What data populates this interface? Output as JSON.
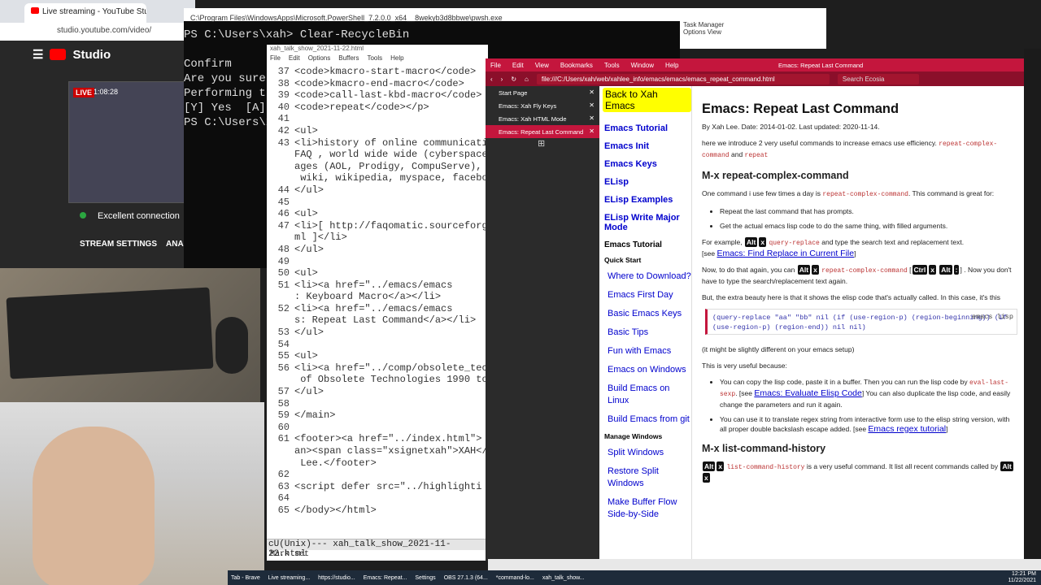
{
  "studio": {
    "tab_title": "Live streaming - YouTube Studio",
    "url": "studio.youtube.com/video/",
    "brand": "Studio",
    "live_badge": "LIVE",
    "live_time": "1:08:28",
    "connection": "Excellent connection",
    "stream_settings": "STREAM SETTINGS",
    "analytics": "ANAL"
  },
  "powershell": {
    "title": "C:\\Program Files\\WindowsApps\\Microsoft.PowerShell_7.2.0.0_x64__8wekyb3d8bbwe\\pwsh.exe",
    "lines": [
      "PS C:\\Users\\xah> Clear-RecycleBin",
      "",
      "Confirm",
      "Are you sure",
      "Performing th",
      "[Y] Yes  [A]",
      "PS C:\\Users\\x"
    ]
  },
  "emacs": {
    "title": "xah_talk_show_2021-11-22.html",
    "menu": [
      "File",
      "Edit",
      "Options",
      "Buffers",
      "Tools",
      "Help"
    ],
    "lines": [
      {
        "n": "37",
        "t": "<code>kmacro-start-macro</code>"
      },
      {
        "n": "38",
        "t": "<code>kmacro-end-macro</code>"
      },
      {
        "n": "39",
        "t": "<code>call-last-kbd-macro</code>"
      },
      {
        "n": "40",
        "t": "<code>repeat</code></p>"
      },
      {
        "n": "41",
        "t": ""
      },
      {
        "n": "42",
        "t": "<ul>"
      },
      {
        "n": "43",
        "t": "<li>history of online communicati"
      },
      {
        "n": "",
        "t": "FAQ , world wide wide (cyberspace"
      },
      {
        "n": "",
        "t": "ages (AOL, Prodigy, CompuServe),"
      },
      {
        "n": "",
        "t": " wiki, wikipedia, myspace, facebo"
      },
      {
        "n": "44",
        "t": "</ul>"
      },
      {
        "n": "45",
        "t": ""
      },
      {
        "n": "46",
        "t": "<ul>"
      },
      {
        "n": "47",
        "t": "<li>[ http://faqomatic.sourceforg"
      },
      {
        "n": "",
        "t": "ml ]</li>"
      },
      {
        "n": "48",
        "t": "</ul>"
      },
      {
        "n": "49",
        "t": ""
      },
      {
        "n": "50",
        "t": "<ul>"
      },
      {
        "n": "51",
        "t": "<li><a href=\"../emacs/emacs"
      },
      {
        "n": "",
        "t": ": Keyboard Macro</a></li>"
      },
      {
        "n": "52",
        "t": "<li><a href=\"../emacs/emacs"
      },
      {
        "n": "",
        "t": "s: Repeat Last Command</a></li>"
      },
      {
        "n": "53",
        "t": "</ul>"
      },
      {
        "n": "54",
        "t": ""
      },
      {
        "n": "55",
        "t": "<ul>"
      },
      {
        "n": "56",
        "t": "<li><a href=\"../comp/obsolete_tec"
      },
      {
        "n": "",
        "t": " of Obsolete Technologies 1990 to"
      },
      {
        "n": "57",
        "t": "</ul>"
      },
      {
        "n": "58",
        "t": ""
      },
      {
        "n": "59",
        "t": "</main>"
      },
      {
        "n": "60",
        "t": ""
      },
      {
        "n": "61",
        "t": "<footer><a href=\"../index.html\">"
      },
      {
        "n": "",
        "t": "an><span class=\"xsignetxah\">XAH</"
      },
      {
        "n": "",
        "t": " Lee.</footer>"
      },
      {
        "n": "62",
        "t": ""
      },
      {
        "n": "63",
        "t": "<script defer src=\"../highlighti"
      },
      {
        "n": "64",
        "t": ""
      },
      {
        "n": "65",
        "t": "</body></html>"
      }
    ],
    "modeline": "cU(Unix)---  xah_talk_show_2021-11-22.html",
    "minibuffer": "Mark set"
  },
  "browser": {
    "window_title": "Emacs: Repeat Last Command",
    "menu": [
      "File",
      "Edit",
      "View",
      "Bookmarks",
      "Tools",
      "Window",
      "Help"
    ],
    "url": "file:///C:/Users/xah/web/xahlee_info/emacs/emacs/emacs_repeat_command.html",
    "search_placeholder": "Search Ecosia",
    "tabs": [
      "Start Page",
      "Emacs: Xah Fly Keys",
      "Emacs: Xah HTML Mode",
      "Emacs: Repeat Last Command"
    ],
    "accent": "#c4163d"
  },
  "nav": {
    "back": "Back to Xah Emacs",
    "top_links": [
      "Emacs Tutorial",
      "Emacs Init",
      "Emacs Keys",
      "ELisp",
      "ELisp Examples",
      "ELisp Write Major Mode"
    ],
    "section": "Emacs Tutorial",
    "quick_start": "Quick Start",
    "quick_links": [
      "Where to Download?",
      "Emacs First Day",
      "Basic Emacs Keys",
      "Basic Tips",
      "Fun with Emacs",
      "Emacs on Windows",
      "Build Emacs on Linux",
      "Build Emacs from git"
    ],
    "manage": "Manage Windows",
    "manage_links": [
      "Split Windows",
      "Restore Split Windows",
      "Make Buffer Flow Side-by-Side"
    ]
  },
  "article": {
    "title": "Emacs: Repeat Last Command",
    "byline": "By Xah Lee. Date: 2014-01-02. Last updated: 2020-11-14.",
    "intro": "here we introduce 2 very useful commands to increase emacs use efficiency.",
    "intro_cmd1": "repeat-complex-command",
    "intro_and": "and",
    "intro_cmd2": "repeat",
    "h2a": "M-x repeat-complex-command",
    "p1a": "One command i use few times a day is",
    "p1cmd": "repeat-complex-command",
    "p1b": ". This command is great for:",
    "li1": "Repeat the last command that has prompts.",
    "li2": "Get the actual emacs lisp code to do the same thing, with filled arguments.",
    "ex_a": "For example,",
    "ex_cmd": "query-replace",
    "ex_b": "and type the search text and replacement text.",
    "see1": "[see",
    "see1_link": "Emacs: Find Replace in Current File",
    "see1_end": "]",
    "now_a": "Now, to do that again, you can",
    "now_cmd": "repeat-complex-command",
    "now_b": ". Now you don't have to type the search/replacement text again.",
    "beauty": "But, the extra beauty here is that it shows the elisp code that's actually called. In this case, it's this",
    "code": "(query-replace \"aa\" \"bb\" nil (if (use-region-p) (region-beginning)) (if (use-region-p) (region-end)) nil nil)",
    "code_lang": "emacs lisp",
    "slight": "(it might be slightly different on your emacs setup)",
    "useful": "This is very useful because:",
    "u1a": "You can copy the lisp code, paste it in a buffer. Then you can run the lisp code by",
    "u1cmd": "eval-last-sexp",
    "u1b": ". [see",
    "u1link": "Emacs: Evaluate Elisp Code",
    "u1c": "] You can also duplicate the lisp code, and easily change the parameters and run it again.",
    "u2a": "You can use it to translate regex string from interactive form use to the elisp string version, with all proper double backslash escape added. [see",
    "u2link": "Emacs regex tutorial",
    "u2b": "]",
    "h2b": "M-x list-command-history",
    "lch_cmd": "list-command-history",
    "lch_a": "is a very useful command. It list all recent commands called by",
    "k_alt": "Alt",
    "k_x": "x",
    "k_ctrl": "Ctrl",
    "k_colon": ":"
  },
  "taskmanager": {
    "title": "Task Manager",
    "menu": "Options  View"
  },
  "taskbar": {
    "items": [
      "Tab - Brave",
      "Live streaming...",
      "https://studio...",
      "Emacs: Repeat...",
      "Settings",
      "OBS 27.1.3 (64...",
      "*command-lo...",
      "xah_talk_show..."
    ],
    "time": "12:21 PM",
    "date": "11/22/2021"
  }
}
